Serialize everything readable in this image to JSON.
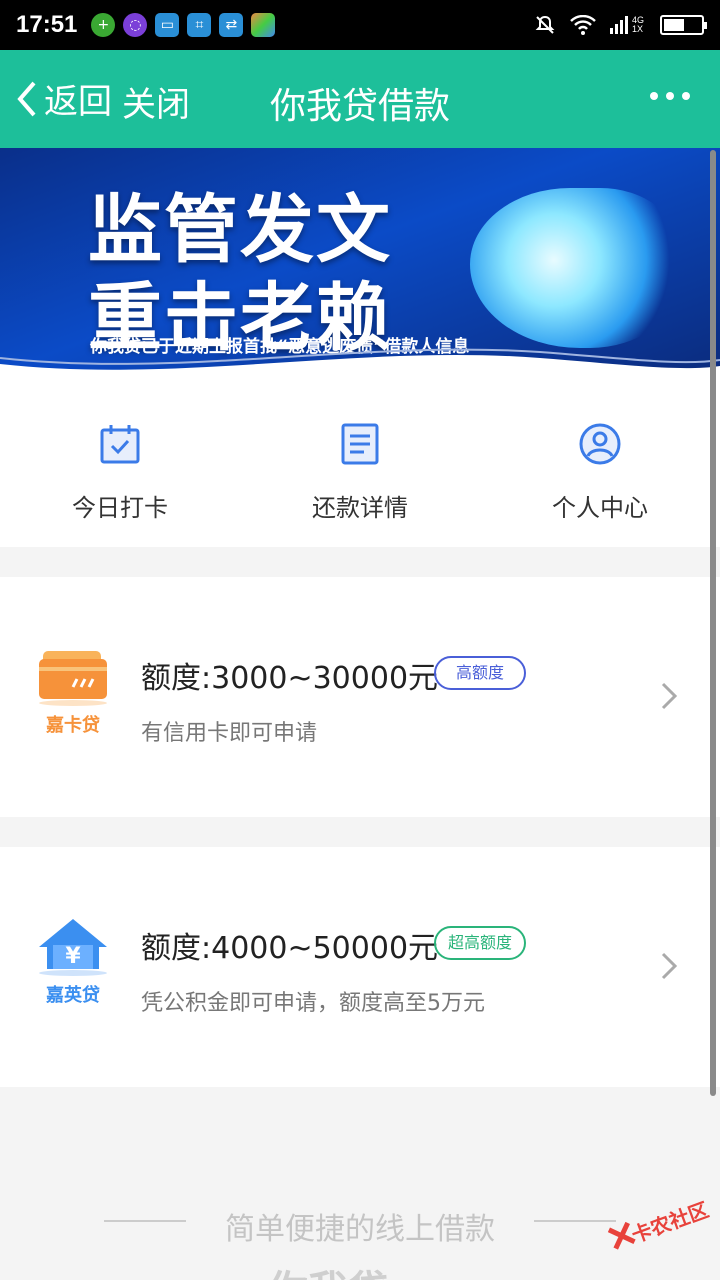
{
  "status_bar": {
    "time": "17:51",
    "network": "4G 1X",
    "icons": [
      "plus-circle-icon",
      "purple-app-icon",
      "chat-icon",
      "scan-icon",
      "exchange-icon",
      "browser-icon",
      "mute-bell-icon",
      "wifi-icon",
      "signal-icon",
      "battery-icon"
    ]
  },
  "header": {
    "back_label": "返回",
    "close_label": "关闭",
    "title": "你我贷借款",
    "accent": "#1dbf9a"
  },
  "banner": {
    "line1": "监管发文",
    "line2": "重击老赖",
    "subtitle": "你我贷已于近期上报首批“恶意逃废债”借款人信息"
  },
  "quick_nav": [
    {
      "label": "今日打卡",
      "icon": "calendar-check-icon"
    },
    {
      "label": "还款详情",
      "icon": "document-list-icon"
    },
    {
      "label": "个人中心",
      "icon": "user-circle-icon"
    }
  ],
  "loans": [
    {
      "name": "嘉卡贷",
      "amount": "额度:3000~30000元",
      "badge": "高额度",
      "desc": "有信用卡即可申请",
      "brand_color": "#f6923a",
      "badge_color": "#4a5fd8"
    },
    {
      "name": "嘉英贷",
      "amount": "额度:4000~50000元",
      "badge": "超高额度",
      "desc": "凭公积金即可申请，额度高至5万元",
      "brand_color": "#3b8ff0",
      "badge_color": "#2ab47a"
    }
  ],
  "footer": {
    "tagline": "简单便捷的线上借款",
    "logo_text": "你我贷"
  },
  "watermark": "卡农社区"
}
